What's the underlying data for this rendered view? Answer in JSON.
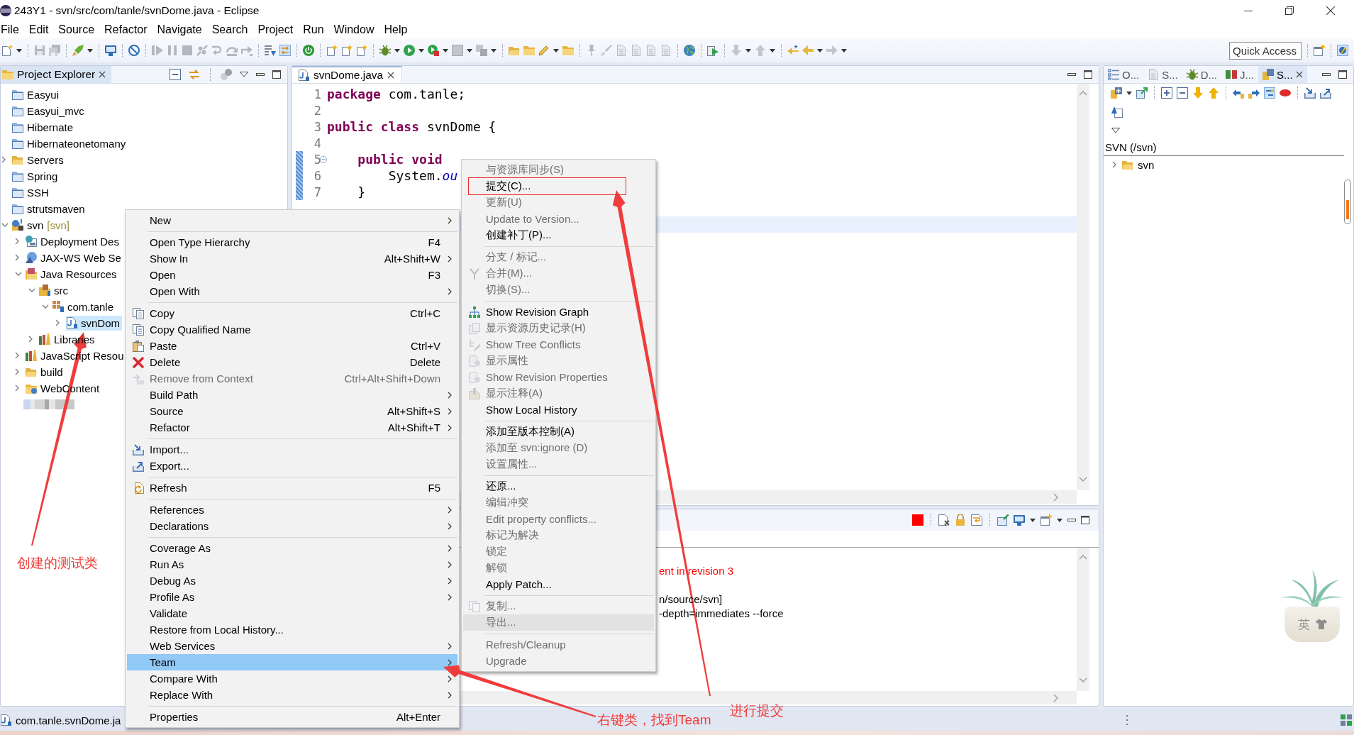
{
  "window": {
    "title": "243Y1 - svn/src/com/tanle/svnDome.java - Eclipse"
  },
  "menu_bar": [
    "File",
    "Edit",
    "Source",
    "Refactor",
    "Navigate",
    "Search",
    "Project",
    "Run",
    "Window",
    "Help"
  ],
  "toolbar": {
    "quick_access": {
      "placeholder": "Quick Access"
    }
  },
  "project_explorer": {
    "title": "Project Explorer",
    "items": [
      {
        "label": "Easyui",
        "kind": "project",
        "selected": false
      },
      {
        "label": "Easyui_mvc",
        "kind": "project",
        "selected": false
      },
      {
        "label": "Hibernate",
        "kind": "project",
        "selected": false
      },
      {
        "label": "Hibernateonetomany",
        "kind": "project",
        "selected": false
      },
      {
        "label": "Servers",
        "kind": "folder",
        "expanded": false,
        "selected": false
      },
      {
        "label": "Spring",
        "kind": "project",
        "selected": false
      },
      {
        "label": "SSH",
        "kind": "project",
        "selected": false
      },
      {
        "label": "strutsmaven",
        "kind": "project",
        "selected": false
      },
      {
        "label": "svn",
        "decoration": "[svn]",
        "kind": "web_project",
        "expanded": true,
        "selected": false,
        "children": [
          {
            "label": "Deployment Des",
            "kind": "descriptor",
            "expanded": false,
            "selected": false
          },
          {
            "label": "JAX-WS Web Se",
            "kind": "web_service",
            "expanded": false,
            "selected": false
          },
          {
            "label": "Java Resources",
            "kind": "java_resources",
            "expanded": true,
            "selected": false,
            "children": [
              {
                "label": "src",
                "kind": "source_folder",
                "expanded": true,
                "selected": false,
                "children": [
                  {
                    "label": "com.tanle",
                    "kind": "package",
                    "expanded": true,
                    "selected": false,
                    "children": [
                      {
                        "label": "svnDom",
                        "kind": "java_file",
                        "expanded": false,
                        "selected": true
                      }
                    ]
                  }
                ]
              },
              {
                "label": "Libraries",
                "kind": "library",
                "expanded": false,
                "selected": false
              }
            ]
          },
          {
            "label": "JavaScript Resou",
            "kind": "library",
            "expanded": false,
            "selected": false
          },
          {
            "label": "build",
            "kind": "folder",
            "expanded": false,
            "selected": false
          },
          {
            "label": "WebContent",
            "kind": "web_folder",
            "expanded": false,
            "selected": false
          }
        ]
      },
      {
        "kind": "redacted",
        "selected": false
      }
    ]
  },
  "editor": {
    "tab": {
      "label": "svnDome.java",
      "selected": true
    },
    "lines": [
      {
        "number": "1",
        "changed": false,
        "foldable": false,
        "tokens": [
          {
            "text": "package",
            "kind": "keyword"
          },
          {
            "text": " com.tanle;",
            "kind": "plain"
          }
        ]
      },
      {
        "number": "2",
        "changed": false,
        "foldable": false
      },
      {
        "number": "3",
        "changed": false,
        "foldable": false,
        "tokens": [
          {
            "text": "public class",
            "kind": "keyword"
          },
          {
            "text": " svnDome {",
            "kind": "plain"
          }
        ]
      },
      {
        "number": "4",
        "changed": false,
        "foldable": false
      },
      {
        "number": "5",
        "changed": true,
        "foldable": true,
        "tokens": [
          {
            "text": "    public void",
            "kind": "keyword"
          }
        ]
      },
      {
        "number": "6",
        "changed": true,
        "foldable": false,
        "tokens": [
          {
            "text": "        System.",
            "kind": "plain"
          },
          {
            "text": "ou",
            "kind": "field"
          }
        ]
      },
      {
        "number": "7",
        "changed": true,
        "foldable": false,
        "tokens": [
          {
            "text": "    }",
            "kind": "plain"
          }
        ]
      }
    ]
  },
  "console": {
    "lines": [
      {
        "text": "ent in revision 3",
        "kind": "error"
      },
      {
        "text": "n/source/svn]",
        "kind": "output"
      },
      {
        "text": "-depth=immediates --force",
        "kind": "output"
      }
    ]
  },
  "svn_view": {
    "tabs": [
      {
        "label": "O...",
        "selected": false
      },
      {
        "label": "S...",
        "selected": false
      },
      {
        "label": "D...",
        "selected": false
      },
      {
        "label": "J...",
        "selected": false
      },
      {
        "label": "S...",
        "selected": true
      }
    ],
    "location": "SVN (/svn)",
    "items": [
      {
        "label": "svn",
        "expanded": false,
        "selected": false
      }
    ]
  },
  "context_menu": {
    "items": [
      {
        "kind": "item",
        "label": "New",
        "submenu": true,
        "disabled": false,
        "selected": false
      },
      {
        "kind": "separator"
      },
      {
        "kind": "item",
        "label": "Open Type Hierarchy",
        "shortcut": "F4",
        "submenu": false,
        "disabled": false,
        "selected": false
      },
      {
        "kind": "item",
        "label": "Show In",
        "shortcut": "Alt+Shift+W",
        "submenu": true,
        "disabled": false,
        "selected": false
      },
      {
        "kind": "item",
        "label": "Open",
        "shortcut": "F3",
        "submenu": false,
        "disabled": false,
        "selected": false
      },
      {
        "kind": "item",
        "label": "Open With",
        "submenu": true,
        "disabled": false,
        "selected": false
      },
      {
        "kind": "separator"
      },
      {
        "kind": "item",
        "label": "Copy",
        "shortcut": "Ctrl+C",
        "submenu": false,
        "disabled": false,
        "selected": false
      },
      {
        "kind": "item",
        "label": "Copy Qualified Name",
        "submenu": false,
        "disabled": false,
        "selected": false
      },
      {
        "kind": "item",
        "label": "Paste",
        "shortcut": "Ctrl+V",
        "submenu": false,
        "disabled": false,
        "selected": false
      },
      {
        "kind": "item",
        "label": "Delete",
        "shortcut": "Delete",
        "submenu": false,
        "disabled": false,
        "selected": false
      },
      {
        "kind": "item",
        "label": "Remove from Context",
        "shortcut": "Ctrl+Alt+Shift+Down",
        "submenu": false,
        "disabled": true,
        "selected": false
      },
      {
        "kind": "item",
        "label": "Build Path",
        "submenu": true,
        "disabled": false,
        "selected": false
      },
      {
        "kind": "item",
        "label": "Source",
        "shortcut": "Alt+Shift+S",
        "submenu": true,
        "disabled": false,
        "selected": false
      },
      {
        "kind": "item",
        "label": "Refactor",
        "shortcut": "Alt+Shift+T",
        "submenu": true,
        "disabled": false,
        "selected": false
      },
      {
        "kind": "separator"
      },
      {
        "kind": "item",
        "label": "Import...",
        "submenu": false,
        "disabled": false,
        "selected": false
      },
      {
        "kind": "item",
        "label": "Export...",
        "submenu": false,
        "disabled": false,
        "selected": false
      },
      {
        "kind": "separator"
      },
      {
        "kind": "item",
        "label": "Refresh",
        "shortcut": "F5",
        "submenu": false,
        "disabled": false,
        "selected": false
      },
      {
        "kind": "separator"
      },
      {
        "kind": "item",
        "label": "References",
        "submenu": true,
        "disabled": false,
        "selected": false
      },
      {
        "kind": "item",
        "label": "Declarations",
        "submenu": true,
        "disabled": false,
        "selected": false
      },
      {
        "kind": "separator"
      },
      {
        "kind": "item",
        "label": "Coverage As",
        "submenu": true,
        "disabled": false,
        "selected": false
      },
      {
        "kind": "item",
        "label": "Run As",
        "submenu": true,
        "disabled": false,
        "selected": false
      },
      {
        "kind": "item",
        "label": "Debug As",
        "submenu": true,
        "disabled": false,
        "selected": false
      },
      {
        "kind": "item",
        "label": "Profile As",
        "submenu": true,
        "disabled": false,
        "selected": false
      },
      {
        "kind": "item",
        "label": "Validate",
        "submenu": false,
        "disabled": false,
        "selected": false
      },
      {
        "kind": "item",
        "label": "Restore from Local History...",
        "submenu": false,
        "disabled": false,
        "selected": false
      },
      {
        "kind": "item",
        "label": "Web Services",
        "submenu": true,
        "disabled": false,
        "selected": false
      },
      {
        "kind": "item",
        "label": "Team",
        "submenu": true,
        "disabled": false,
        "selected": true
      },
      {
        "kind": "item",
        "label": "Compare With",
        "submenu": true,
        "disabled": false,
        "selected": false
      },
      {
        "kind": "item",
        "label": "Replace With",
        "submenu": true,
        "disabled": false,
        "selected": false
      },
      {
        "kind": "separator"
      },
      {
        "kind": "item",
        "label": "Properties",
        "shortcut": "Alt+Enter",
        "submenu": false,
        "disabled": false,
        "selected": false
      }
    ]
  },
  "team_submenu": {
    "items": [
      {
        "kind": "item",
        "label": "与资源库同步(S)",
        "disabled": true,
        "selected": false,
        "outlined": false
      },
      {
        "kind": "item",
        "label": "提交(C)...",
        "disabled": false,
        "selected": false,
        "outlined": true
      },
      {
        "kind": "item",
        "label": "更新(U)",
        "disabled": true,
        "selected": false,
        "outlined": false
      },
      {
        "kind": "item",
        "label": "Update to Version...",
        "disabled": true,
        "selected": false,
        "outlined": false
      },
      {
        "kind": "item",
        "label": "创建补丁(P)...",
        "disabled": false,
        "selected": false,
        "outlined": false
      },
      {
        "kind": "separator"
      },
      {
        "kind": "item",
        "label": "分支 / 标记...",
        "disabled": true,
        "selected": false,
        "outlined": false
      },
      {
        "kind": "item",
        "label": "合并(M)...",
        "disabled": true,
        "selected": false,
        "outlined": false
      },
      {
        "kind": "item",
        "label": "切换(S)...",
        "disabled": true,
        "selected": false,
        "outlined": false
      },
      {
        "kind": "separator"
      },
      {
        "kind": "item",
        "label": "Show Revision Graph",
        "disabled": false,
        "selected": false,
        "outlined": false
      },
      {
        "kind": "item",
        "label": "显示资源历史记录(H)",
        "disabled": true,
        "selected": false,
        "outlined": false
      },
      {
        "kind": "item",
        "label": "Show Tree Conflicts",
        "disabled": true,
        "selected": false,
        "outlined": false
      },
      {
        "kind": "item",
        "label": "显示属性",
        "disabled": true,
        "selected": false,
        "outlined": false
      },
      {
        "kind": "item",
        "label": "Show Revision Properties",
        "disabled": true,
        "selected": false,
        "outlined": false
      },
      {
        "kind": "item",
        "label": "显示注释(A)",
        "disabled": true,
        "selected": false,
        "outlined": false
      },
      {
        "kind": "item",
        "label": "Show Local History",
        "disabled": false,
        "selected": false,
        "outlined": false
      },
      {
        "kind": "separator"
      },
      {
        "kind": "item",
        "label": "添加至版本控制(A)",
        "disabled": false,
        "selected": false,
        "outlined": false
      },
      {
        "kind": "item",
        "label": "添加至 svn:ignore (D)",
        "disabled": true,
        "selected": false,
        "outlined": false
      },
      {
        "kind": "item",
        "label": "设置属性...",
        "disabled": true,
        "selected": false,
        "outlined": false
      },
      {
        "kind": "separator"
      },
      {
        "kind": "item",
        "label": "还原...",
        "disabled": false,
        "selected": false,
        "outlined": false
      },
      {
        "kind": "item",
        "label": "编辑冲突",
        "disabled": true,
        "selected": false,
        "outlined": false
      },
      {
        "kind": "item",
        "label": "Edit property conflicts...",
        "disabled": true,
        "selected": false,
        "outlined": false
      },
      {
        "kind": "item",
        "label": "标记为解决",
        "disabled": true,
        "selected": false,
        "outlined": false
      },
      {
        "kind": "item",
        "label": "锁定",
        "disabled": true,
        "selected": false,
        "outlined": false
      },
      {
        "kind": "item",
        "label": "解锁",
        "disabled": true,
        "selected": false,
        "outlined": false
      },
      {
        "kind": "item",
        "label": "Apply Patch...",
        "disabled": false,
        "selected": false,
        "outlined": false
      },
      {
        "kind": "separator"
      },
      {
        "kind": "item",
        "label": "复制...",
        "disabled": true,
        "selected": false,
        "outlined": false
      },
      {
        "kind": "item",
        "label": "导出...",
        "disabled": true,
        "selected": true,
        "outlined": false
      },
      {
        "kind": "separator"
      },
      {
        "kind": "item",
        "label": "Refresh/Cleanup",
        "disabled": true,
        "selected": false,
        "outlined": false
      },
      {
        "kind": "item",
        "label": "Upgrade",
        "disabled": true,
        "selected": false,
        "outlined": false
      }
    ]
  },
  "status_bar": {
    "text": "com.tanle.svnDome.ja"
  },
  "ime_widget": {
    "label": "英"
  },
  "annotations": [
    {
      "text": "创建的测试类"
    },
    {
      "text": "进行提交"
    },
    {
      "text": "右键类，找到Team"
    }
  ]
}
